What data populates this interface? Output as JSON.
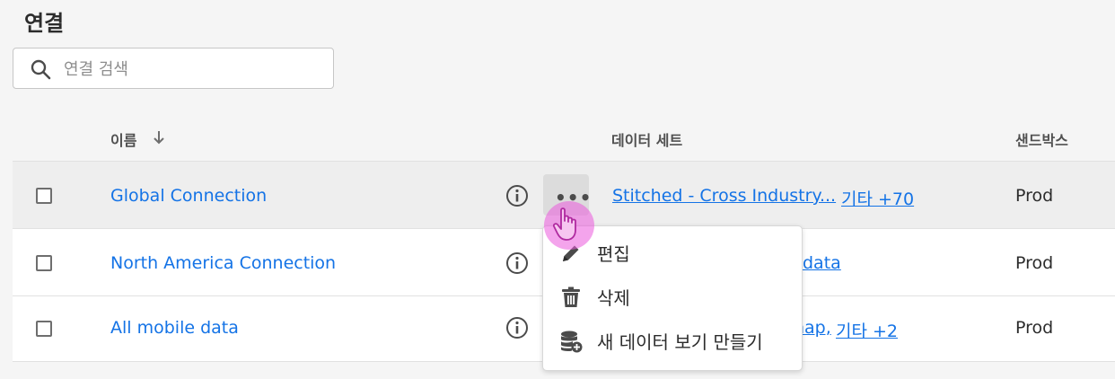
{
  "page": {
    "title": "연결"
  },
  "search": {
    "placeholder": "연결 검색",
    "value": ""
  },
  "columns": {
    "name": "이름",
    "datasets": "데이터 세트",
    "sandbox": "샌드박스"
  },
  "rows": [
    {
      "name": "Global Connection",
      "dataset_link": "Stitched - Cross Industry...",
      "more_link": "기타 +70",
      "sandbox": "Prod"
    },
    {
      "name": "North America Connection",
      "dataset_link": "data",
      "sandbox": "Prod"
    },
    {
      "name": "All mobile data",
      "dataset_link": "nap,",
      "more_link": "기타 +2",
      "sandbox": "Prod"
    }
  ],
  "context_menu": {
    "items": [
      {
        "label": "편집",
        "icon": "pencil-icon"
      },
      {
        "label": "삭제",
        "icon": "trash-icon"
      },
      {
        "label": "새 데이터 보기 만들기",
        "icon": "database-add-icon"
      }
    ]
  },
  "colors": {
    "link": "#1473e6",
    "cursor_halo": "#eb5adc"
  }
}
